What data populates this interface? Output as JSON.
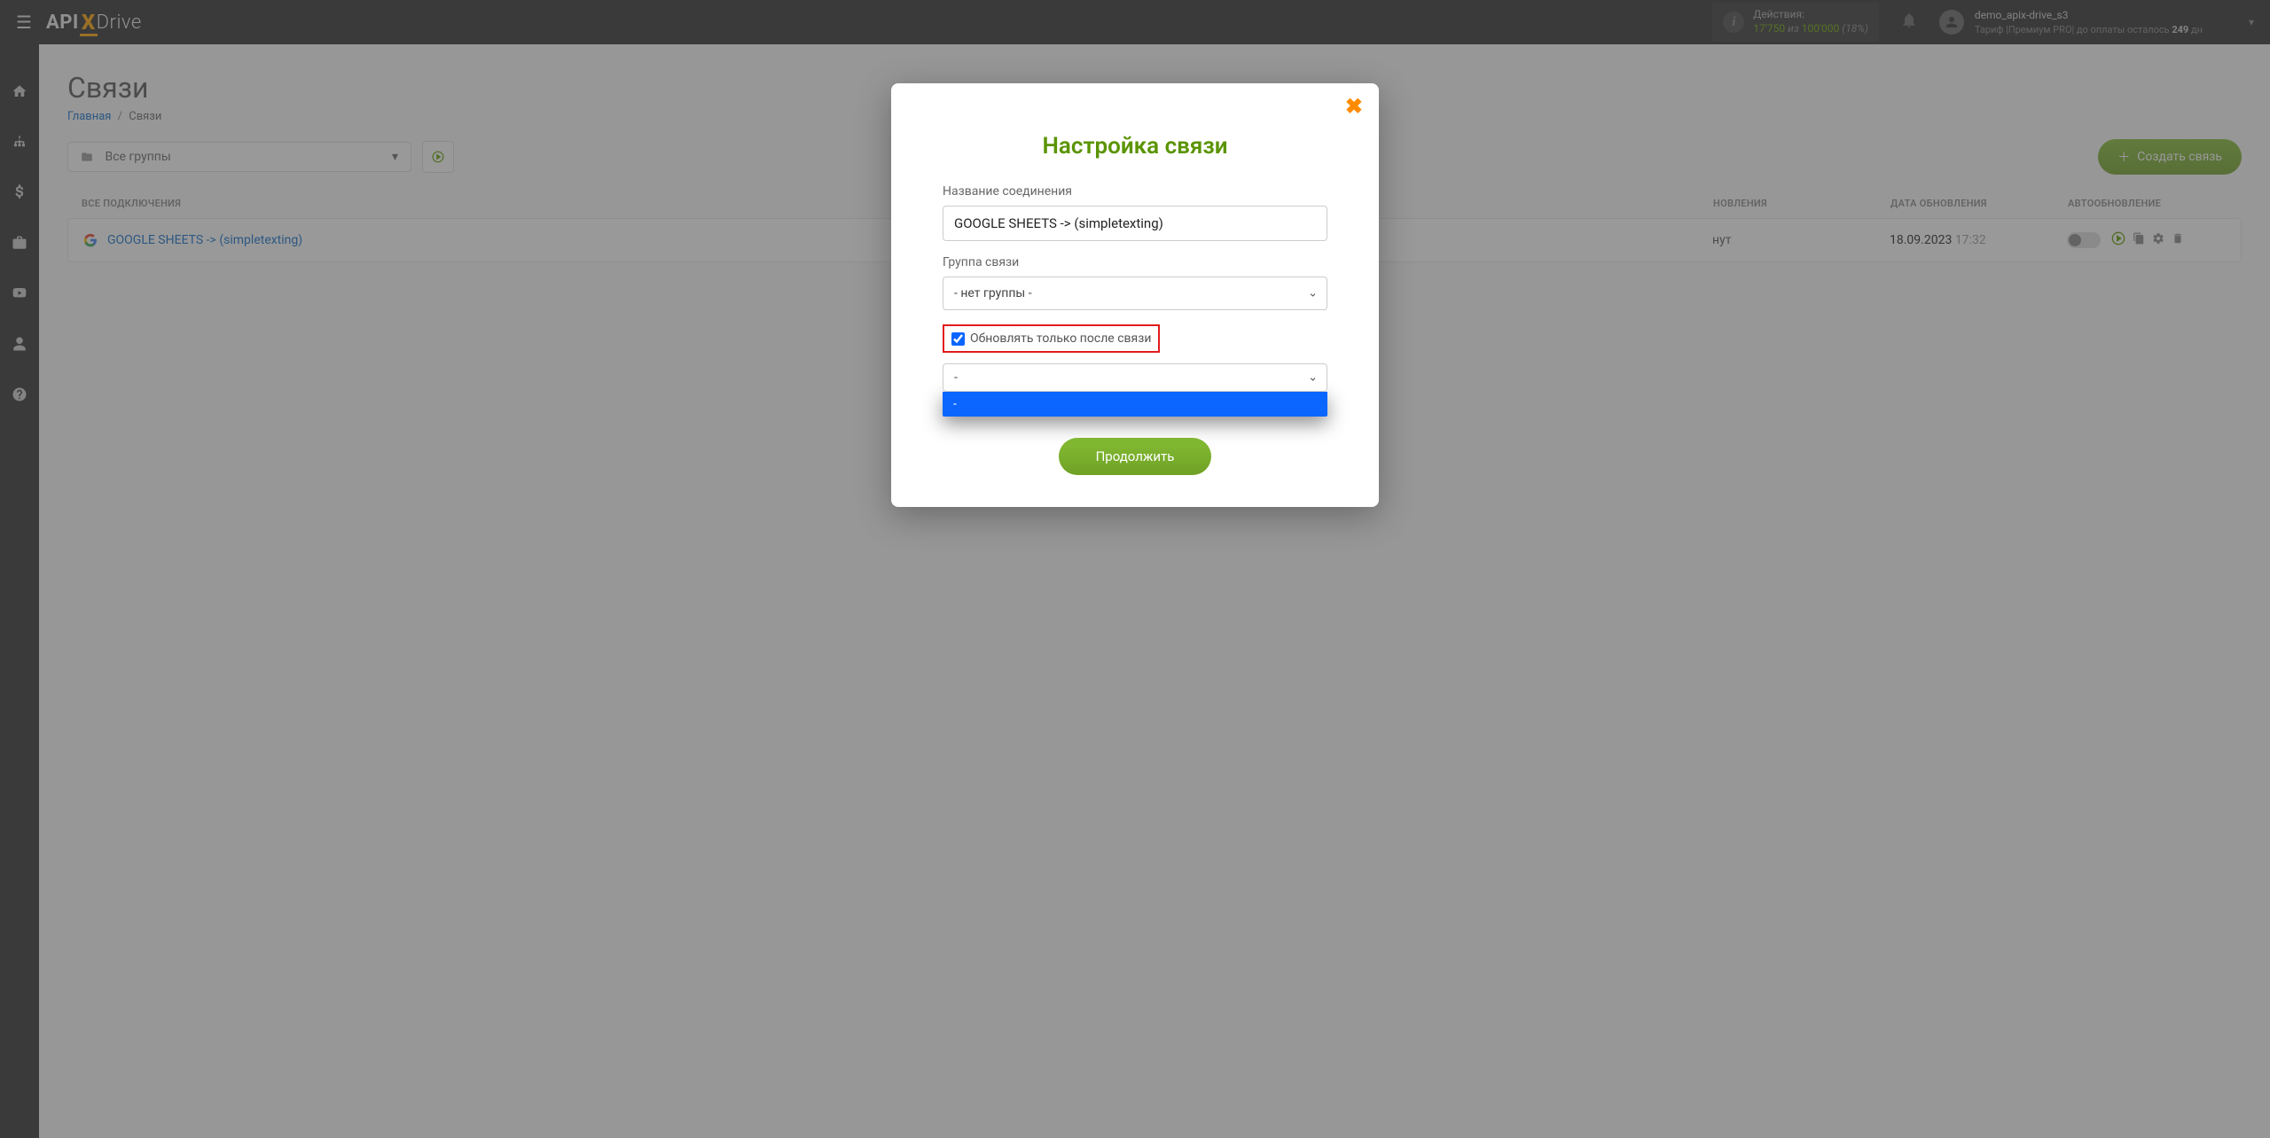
{
  "brand": {
    "part1": "API",
    "x": "X",
    "part2": "Drive"
  },
  "header": {
    "actions_label": "Действия:",
    "actions_used": "17'750",
    "actions_iz": "из",
    "actions_total": "100'000",
    "actions_pct": "(18%)",
    "username": "demo_apix-drive_s3",
    "tariff_prefix": "Тариф |Премиум PRO| до оплаты осталось ",
    "tariff_days": "249",
    "tariff_suffix": " дн"
  },
  "page": {
    "title": "Связи",
    "breadcrumb_home": "Главная",
    "breadcrumb_current": "Связи"
  },
  "toolbar": {
    "group_select": "Все группы",
    "create_btn": "Создать связь"
  },
  "table": {
    "col_name": "ВСЕ ПОДКЛЮЧЕНИЯ",
    "col_update": "НОВЛЕНИЯ",
    "col_date": "ДАТА ОБНОВЛЕНИЯ",
    "col_auto": "АВТООБНОВЛЕНИЕ"
  },
  "row": {
    "name": "GOOGLE SHEETS -> (simpletexting)",
    "update_suffix": "нут",
    "date": "18.09.2023",
    "time": "17:32"
  },
  "modal": {
    "title": "Настройка связи",
    "name_label": "Название соединения",
    "name_value": "GOOGLE SHEETS -> (simpletexting)",
    "group_label": "Группа связи",
    "group_value": "- нет группы -",
    "checkbox_label": "Обновлять только после связи",
    "depend_value": "-",
    "dropdown_option": "-",
    "continue": "Продолжить"
  }
}
